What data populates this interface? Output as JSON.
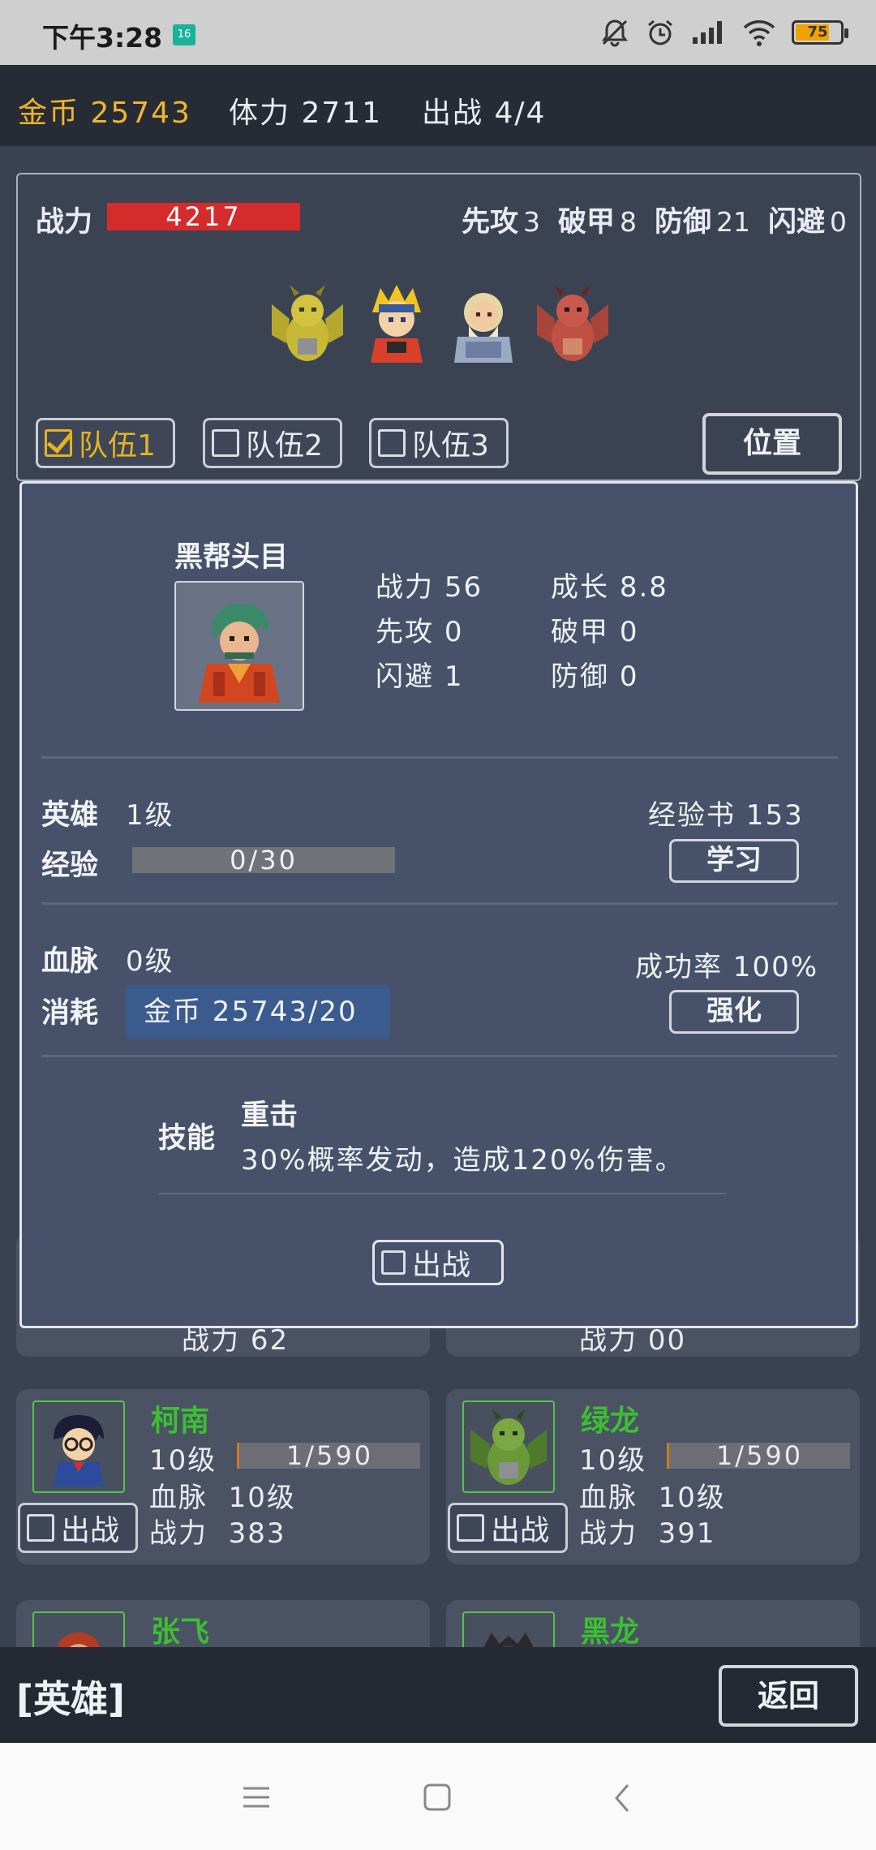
{
  "status_bar": {
    "time": "下午3:28",
    "notif_badge": "16",
    "battery_level": "75"
  },
  "resources": {
    "gold": "金币 25743",
    "stamina": "体力 2711",
    "deploy": "出战 4/4"
  },
  "team": {
    "power_label": "战力",
    "power_value": "4217",
    "stats": [
      {
        "label": "先攻",
        "value": "3"
      },
      {
        "label": "破甲",
        "value": "8"
      },
      {
        "label": "防御",
        "value": "21"
      },
      {
        "label": "闪避",
        "value": "0"
      }
    ],
    "tabs": [
      {
        "label": "队伍1",
        "checked": true
      },
      {
        "label": "队伍2",
        "checked": false
      },
      {
        "label": "队伍3",
        "checked": false
      }
    ],
    "position_button": "位置"
  },
  "hero_list": [
    {
      "name": "柯南",
      "level": "10级",
      "xp": "1/590",
      "bloodline_label": "血脉",
      "bloodline": "10级",
      "power_label": "战力",
      "power": "383",
      "deploy_label": "出战"
    },
    {
      "name": "绿龙",
      "level": "10级",
      "xp": "1/590",
      "bloodline_label": "血脉",
      "bloodline": "10级",
      "power_label": "战力",
      "power": "391",
      "deploy_label": "出战"
    },
    {
      "name": "张飞"
    },
    {
      "name": "黑龙"
    }
  ],
  "partial_row": {
    "power_label": "战力",
    "left_value": "62",
    "right_value": "00"
  },
  "detail": {
    "name": "黑帮头目",
    "stats": [
      {
        "label": "战力",
        "value": "56"
      },
      {
        "label": "成长",
        "value": "8.8"
      },
      {
        "label": "先攻",
        "value": "0"
      },
      {
        "label": "破甲",
        "value": "0"
      },
      {
        "label": "闪避",
        "value": "1"
      },
      {
        "label": "防御",
        "value": "0"
      }
    ],
    "hero_label": "英雄",
    "hero_level": "1级",
    "xp_label": "经验",
    "xp_value": "0/30",
    "xp_fraction": 0,
    "xp_book": "经验书 153",
    "learn_button": "学习",
    "bloodline_label": "血脉",
    "bloodline_level": "0级",
    "success_rate": "成功率 100%",
    "cost_label": "消耗",
    "cost_value": "金币 25743/20",
    "enhance_button": "强化",
    "skill_label": "技能",
    "skill_name": "重击",
    "skill_desc": "30%概率发动，造成120%伤害。",
    "deploy_label": "出战"
  },
  "footer": {
    "title": "[英雄]",
    "back_button": "返回"
  }
}
